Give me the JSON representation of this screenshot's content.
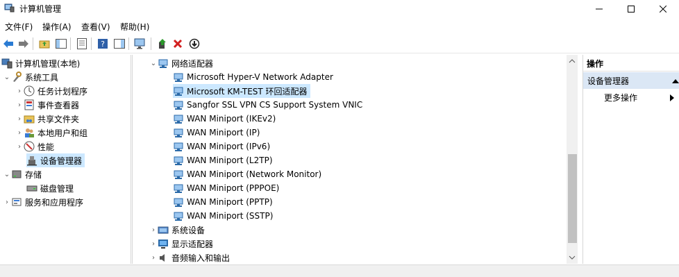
{
  "window": {
    "title": "计算机管理",
    "buttons": {
      "minimize": "minimize",
      "maximize": "maximize",
      "close": "close"
    }
  },
  "menubar": [
    {
      "label": "文件(F)"
    },
    {
      "label": "操作(A)"
    },
    {
      "label": "查看(V)"
    },
    {
      "label": "帮助(H)"
    }
  ],
  "tree": {
    "root": "计算机管理(本地)",
    "groups": [
      {
        "label": "系统工具",
        "children": [
          "任务计划程序",
          "事件查看器",
          "共享文件夹",
          "本地用户和组",
          "性能",
          "设备管理器"
        ]
      },
      {
        "label": "存储",
        "children": [
          "磁盘管理"
        ]
      },
      {
        "label": "服务和应用程序"
      }
    ]
  },
  "devices": {
    "category_expanded": "网络适配器",
    "adapters": [
      "Microsoft Hyper-V Network Adapter",
      "Microsoft KM-TEST 环回适配器",
      "Sangfor SSL VPN CS Support System VNIC",
      "WAN Miniport (IKEv2)",
      "WAN Miniport (IP)",
      "WAN Miniport (IPv6)",
      "WAN Miniport (L2TP)",
      "WAN Miniport (Network Monitor)",
      "WAN Miniport (PPPOE)",
      "WAN Miniport (PPTP)",
      "WAN Miniport (SSTP)"
    ],
    "collapsed_categories": [
      "系统设备",
      "显示适配器",
      "音频输入和输出"
    ]
  },
  "actions": {
    "header": "操作",
    "group": "设备管理器",
    "more": "更多操作"
  },
  "colors": {
    "selection": "#cce8ff",
    "action_group": "#dbe7f5"
  }
}
